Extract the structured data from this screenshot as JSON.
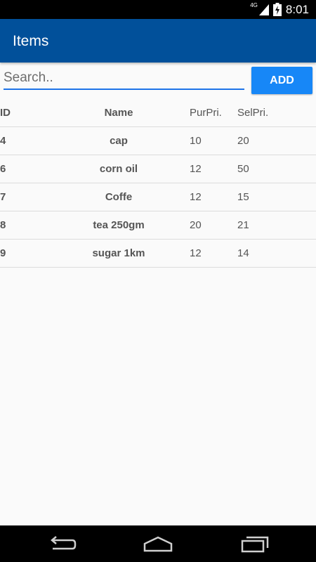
{
  "status_bar": {
    "network": "4G",
    "time": "8:01"
  },
  "app_bar": {
    "title": "Items"
  },
  "search": {
    "placeholder": "Search.."
  },
  "toolbar": {
    "add_label": "ADD"
  },
  "table": {
    "headers": {
      "id": "ID",
      "name": "Name",
      "pur_price": "PurPri.",
      "sel_price": "SelPri."
    },
    "rows": [
      {
        "id": "4",
        "name": "cap",
        "pur_price": "10",
        "sel_price": "20"
      },
      {
        "id": "6",
        "name": "corn oil",
        "pur_price": "12",
        "sel_price": "50"
      },
      {
        "id": "7",
        "name": "Coffe",
        "pur_price": "12",
        "sel_price": "15"
      },
      {
        "id": "8",
        "name": "tea 250gm",
        "pur_price": "20",
        "sel_price": "21"
      },
      {
        "id": "9",
        "name": "sugar 1km",
        "pur_price": "12",
        "sel_price": "14"
      }
    ]
  },
  "colors": {
    "app_bar": "#01509a",
    "accent": "#1787f7",
    "search_underline": "#1e73e8"
  },
  "icons": {
    "signal": "signal-icon",
    "battery": "battery-charging-icon",
    "back": "back-icon",
    "home": "home-icon",
    "recents": "recents-icon"
  }
}
